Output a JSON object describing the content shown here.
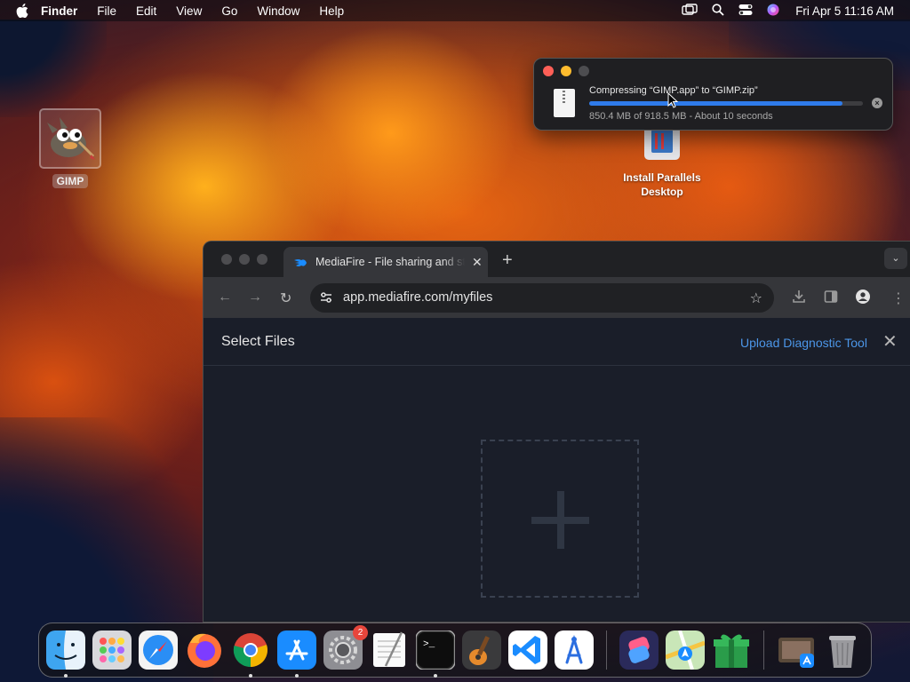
{
  "menubar": {
    "app_name": "Finder",
    "menus": [
      "File",
      "Edit",
      "View",
      "Go",
      "Window",
      "Help"
    ],
    "clock": "Fri Apr 5  11:16 AM",
    "status_icons": [
      "screen-mirroring-icon",
      "spotlight-search-icon",
      "control-center-icon",
      "siri-icon"
    ]
  },
  "desktop": {
    "icons": [
      {
        "label": "GIMP",
        "icon": "gimp-wilber-icon",
        "selected": true
      },
      {
        "label": "Install Parallels Desktop",
        "icon": "parallels-installer-icon"
      }
    ]
  },
  "compress_panel": {
    "title": "Compressing “GIMP.app” to “GIMP.zip”",
    "status": "850.4 MB of 918.5 MB - About 10 seconds",
    "progress": 0.926,
    "colors": {
      "progress": "#2f7bea"
    }
  },
  "browser": {
    "tab_title": "MediaFire - File sharing and storage",
    "url": "app.mediafire.com/myfiles",
    "page": {
      "heading": "Select Files",
      "link": "Upload Diagnostic Tool",
      "close_symbol": "✕",
      "dropzone_symbol": "plus-icon"
    },
    "colors": {
      "link": "#4c96e8",
      "page_bg": "#1a1e29"
    }
  },
  "dock": {
    "apps": [
      {
        "name": "Finder",
        "icon": "finder-icon",
        "running": true
      },
      {
        "name": "Launchpad",
        "icon": "launchpad-icon",
        "running": false
      },
      {
        "name": "Safari",
        "icon": "safari-icon",
        "running": false
      },
      {
        "name": "Firefox",
        "icon": "firefox-icon",
        "running": false
      },
      {
        "name": "Google Chrome",
        "icon": "chrome-icon",
        "running": true
      },
      {
        "name": "App Store",
        "icon": "app-store-icon",
        "running": true
      },
      {
        "name": "System Settings",
        "icon": "system-settings-icon",
        "running": false,
        "badge": "2"
      },
      {
        "name": "TextEdit",
        "icon": "textedit-icon",
        "running": false
      },
      {
        "name": "Terminal",
        "icon": "terminal-icon",
        "running": true
      },
      {
        "name": "GarageBand",
        "icon": "garageband-icon",
        "running": false
      },
      {
        "name": "Visual Studio Code",
        "icon": "vscode-icon",
        "running": false
      },
      {
        "name": "Xcode Instruments",
        "icon": "instruments-icon",
        "running": false
      },
      {
        "name": "Shortcuts",
        "icon": "shortcuts-icon",
        "running": false
      },
      {
        "name": "Maps",
        "icon": "maps-icon",
        "running": false
      },
      {
        "name": "Gift",
        "icon": "gift-icon",
        "running": false
      },
      {
        "name": "Downloads",
        "icon": "downloads-stack-icon",
        "running": false
      },
      {
        "name": "Trash",
        "icon": "trash-icon",
        "running": false
      }
    ],
    "badge_color": "#e8463c"
  }
}
